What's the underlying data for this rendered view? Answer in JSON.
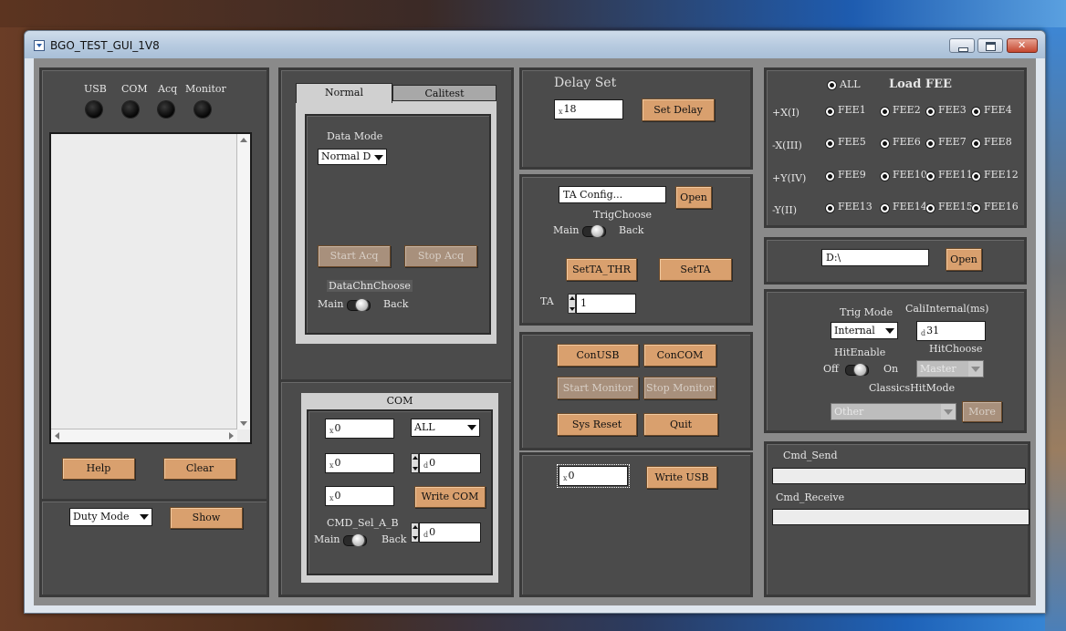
{
  "window": {
    "title": "BGO_TEST_GUI_1V8"
  },
  "status": {
    "indicators": [
      "USB",
      "COM",
      "Acq",
      "Monitor"
    ]
  },
  "log": {
    "help_label": "Help",
    "clear_label": "Clear"
  },
  "mode": {
    "selected": "Duty Mode",
    "show_label": "Show"
  },
  "tabs": {
    "active": "Normal",
    "other": "Calitest"
  },
  "normal": {
    "data_mode_label": "Data Mode",
    "data_mode_value": "Normal Da",
    "start_acq": "Start Acq",
    "stop_acq": "Stop Acq",
    "data_chn_choose": "DataChnChoose",
    "main": "Main",
    "back": "Back"
  },
  "com": {
    "title": "COM",
    "field1": "0",
    "field1_prefix": "x",
    "all_value": "ALL",
    "field2": "0",
    "field2_prefix": "x",
    "field2b": "0",
    "field2b_prefix": "d",
    "field3": "0",
    "field3_prefix": "x",
    "write_com": "Write COM",
    "cmd_sel": "CMD_Sel_A_B",
    "main": "Main",
    "back": "Back",
    "cmd_sel_value": "0",
    "cmd_sel_prefix": "d"
  },
  "delay": {
    "title": "Delay Set",
    "value": "18",
    "prefix": "x",
    "button": "Set Delay"
  },
  "ta": {
    "config_value": "TA Config...",
    "open": "Open",
    "trig_choose": "TrigChoose",
    "main": "Main",
    "back": "Back",
    "set_thr": "SetTA_THR",
    "set_ta": "SetTA",
    "ta_label": "TA",
    "ta_value": "1"
  },
  "connect": {
    "con_usb": "ConUSB",
    "con_com": "ConCOM",
    "start_monitor": "Start Monitor",
    "stop_monitor": "Stop Monitor",
    "sys_reset": "Sys Reset",
    "quit": "Quit"
  },
  "usb_write": {
    "value": "0",
    "prefix": "x",
    "button": "Write USB"
  },
  "fee": {
    "title": "Load FEE",
    "all": "ALL",
    "rows": [
      {
        "label": "+X(I)",
        "items": [
          "FEE1",
          "FEE2",
          "FEE3",
          "FEE4"
        ]
      },
      {
        "label": "-X(III)",
        "items": [
          "FEE5",
          "FEE6",
          "FEE7",
          "FEE8"
        ]
      },
      {
        "label": "+Y(IV)",
        "items": [
          "FEE9",
          "FEE10",
          "FEE11",
          "FEE12"
        ]
      },
      {
        "label": "-Y(II)",
        "items": [
          "FEE13",
          "FEE14",
          "FEE15",
          "FEE16"
        ]
      }
    ]
  },
  "path": {
    "value": "D:\\",
    "open": "Open"
  },
  "trig": {
    "trig_mode_label": "Trig Mode",
    "trig_mode_value": "Internal",
    "cali_internal_label": "CaliInternal(ms)",
    "cali_value": "31",
    "cali_prefix": "d",
    "hit_enable": "HitEnable",
    "off": "Off",
    "on": "On",
    "hit_choose": "HitChoose",
    "hit_choose_value": "Master",
    "classics_label": "ClassicsHitMode",
    "classics_value": "Other",
    "more": "More"
  },
  "cmd": {
    "send_label": "Cmd_Send",
    "receive_label": "Cmd_Receive"
  }
}
